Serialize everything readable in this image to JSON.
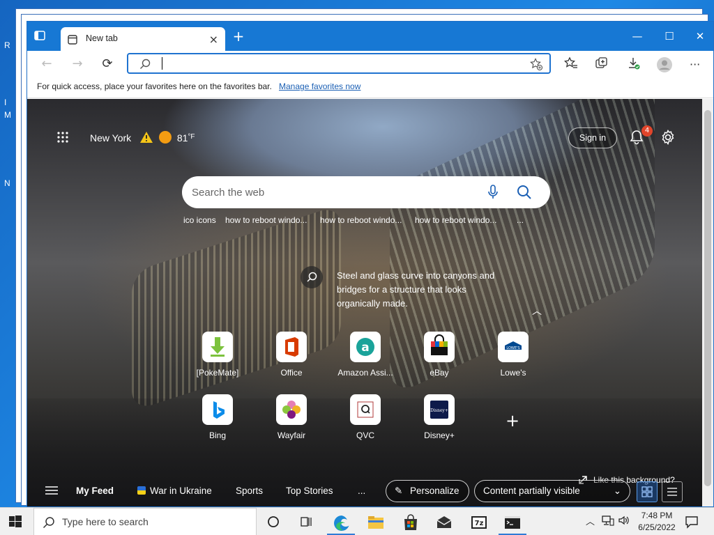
{
  "desktop": {
    "icon_labels": [
      "R",
      "I",
      "M",
      "N"
    ]
  },
  "browser": {
    "tab_title": "New tab",
    "address_value": "",
    "favorites_message": "For quick access, place your favorites here on the favorites bar.",
    "favorites_link": "Manage favorites now"
  },
  "newtab": {
    "weather_city": "New York",
    "weather_temp": "81",
    "weather_unit": "°F",
    "sign_in": "Sign in",
    "notification_count": "4",
    "search_placeholder": "Search the web",
    "trending": [
      "ico icons",
      "how to reboot windo...",
      "how to reboot windo...",
      "how to reboot windo...",
      "..."
    ],
    "caption": "Steel and glass curve into canyons and bridges for a structure that looks organically made.",
    "tiles": [
      {
        "label": "[PokeMate]"
      },
      {
        "label": "Office"
      },
      {
        "label": "Amazon Assi..."
      },
      {
        "label": "eBay"
      },
      {
        "label": "Lowe's",
        "logo_text": "LOWE'S"
      },
      {
        "label": "Bing"
      },
      {
        "label": "Wayfair"
      },
      {
        "label": "QVC"
      },
      {
        "label": "Disney+",
        "logo_text": "Disney+"
      }
    ],
    "like_background": "Like this background?",
    "feed": {
      "my_feed": "My Feed",
      "war": "War in Ukraine",
      "sports": "Sports",
      "top_stories": "Top Stories",
      "more": "...",
      "personalize": "Personalize",
      "content_visibility": "Content partially visible"
    }
  },
  "taskbar": {
    "search_placeholder": "Type here to search",
    "time": "7:48 PM",
    "date": "6/25/2022",
    "app_7z_label": "7z"
  },
  "colors": {
    "accent": "#1778d4",
    "link": "#1a5fb4",
    "badge": "#e0452b"
  }
}
